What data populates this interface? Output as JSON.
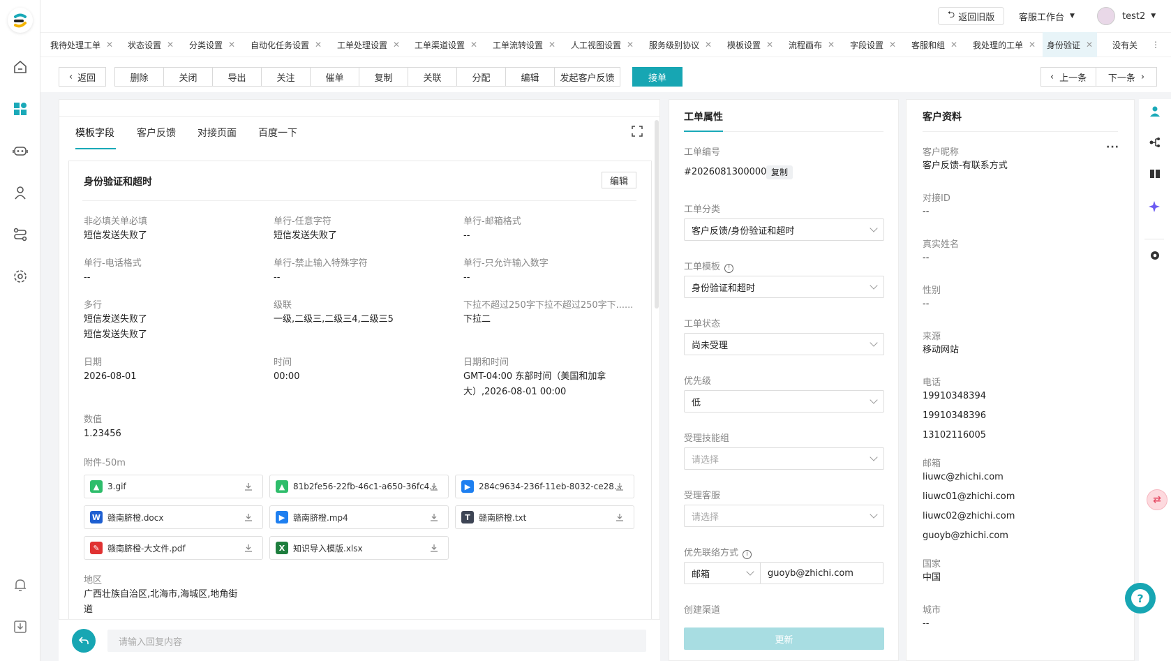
{
  "header": {
    "back_old": "返回旧版",
    "workspace": "客服工作台",
    "user": "test2"
  },
  "tabs": [
    {
      "label": "我待处理工单"
    },
    {
      "label": "状态设置"
    },
    {
      "label": "分类设置"
    },
    {
      "label": "自动化任务设置"
    },
    {
      "label": "工单处理设置"
    },
    {
      "label": "工单渠道设置"
    },
    {
      "label": "工单流转设置"
    },
    {
      "label": "人工视图设置"
    },
    {
      "label": "服务级别协议"
    },
    {
      "label": "模板设置"
    },
    {
      "label": "流程画布"
    },
    {
      "label": "字段设置"
    },
    {
      "label": "客服和组"
    },
    {
      "label": "我处理的工单"
    },
    {
      "label": "身份验证"
    },
    {
      "label": "没有关"
    }
  ],
  "actions": {
    "back": "返回",
    "buttons": [
      "删除",
      "关闭",
      "导出",
      "关注",
      "催单",
      "复制",
      "关联",
      "分配",
      "编辑",
      "发起客户反馈"
    ],
    "accept": "接单",
    "prev": "上一条",
    "next": "下一条"
  },
  "content_tabs": [
    "模板字段",
    "客户反馈",
    "对接页面",
    "百度一下"
  ],
  "section": {
    "title": "身份验证和超时",
    "edit": "编辑"
  },
  "fields": [
    {
      "label": "非必填关单必填",
      "value": "短信发送失败了"
    },
    {
      "label": "单行-任意字符",
      "value": "短信发送失败了"
    },
    {
      "label": "单行-邮箱格式",
      "value": "--"
    },
    {
      "label": "单行-电话格式",
      "value": "--"
    },
    {
      "label": "单行-禁止输入特殊字符",
      "value": "--"
    },
    {
      "label": "单行-只允许输入数字",
      "value": "--"
    },
    {
      "label": "多行",
      "value": "短信发送失败了",
      "value2": "短信发送失败了"
    },
    {
      "label": "级联",
      "value": "一级,二级三,二级三4,二级三5"
    },
    {
      "label": "下拉不超过250字下拉不超过250字下......",
      "value": "下拉二"
    },
    {
      "label": "日期",
      "value": "2026-08-01"
    },
    {
      "label": "时间",
      "value": "00:00"
    },
    {
      "label": "日期和时间",
      "value": "GMT-04:00 东部时间（美国和加拿",
      "value2": "大）,2026-08-01 00:00"
    },
    {
      "label": "数值",
      "value": "1.23456"
    }
  ],
  "attachments": {
    "label": "附件-50m",
    "files": [
      {
        "name": "3.gif",
        "type": "img",
        "color": "#2ebd6b",
        "glyph": "▲"
      },
      {
        "name": "81b2fe56-22fb-46c1-a650-36fc4...",
        "type": "img",
        "color": "#2ebd6b",
        "glyph": "▲"
      },
      {
        "name": "284c9634-236f-11eb-8032-ce28...",
        "type": "video",
        "color": "#1e7ff0",
        "glyph": "▶"
      },
      {
        "name": "赣南脐橙.docx",
        "type": "word",
        "color": "#1e5fd1",
        "glyph": "W"
      },
      {
        "name": "赣南脐橙.mp4",
        "type": "video",
        "color": "#1e7ff0",
        "glyph": "▶"
      },
      {
        "name": "赣南脐橙.txt",
        "type": "text",
        "color": "#3d4454",
        "glyph": "T"
      },
      {
        "name": "赣南脐橙-大文件.pdf",
        "type": "pdf",
        "color": "#e03232",
        "glyph": "✎"
      },
      {
        "name": "知识导入模版.xlsx",
        "type": "excel",
        "color": "#1e7e3e",
        "glyph": "X"
      }
    ]
  },
  "region": {
    "label": "地区",
    "value": "广西壮族自治区,北海市,海城区,地角街",
    "value2": "道"
  },
  "reply": {
    "placeholder": "请输入回复内容"
  },
  "props": {
    "title": "工单属性",
    "id_label": "工单编号",
    "id": "#20260813000002",
    "copy": "复制",
    "category_label": "工单分类",
    "category": "客户反馈/身份验证和超时",
    "template_label": "工单模板",
    "template": "身份验证和超时",
    "status_label": "工单状态",
    "status": "尚未受理",
    "priority_label": "优先级",
    "priority": "低",
    "group_label": "受理技能组",
    "group_ph": "请选择",
    "agent_label": "受理客服",
    "agent_ph": "请选择",
    "contact_label": "优先联络方式",
    "contact_type": "邮箱",
    "contact_value": "guoyb@zhichi.com",
    "channel_label": "创建渠道",
    "update": "更新"
  },
  "customer": {
    "title": "客户资料",
    "more": "···",
    "items": [
      {
        "label": "客户昵称",
        "values": [
          "客户反馈-有联系方式"
        ]
      },
      {
        "label": "对接ID",
        "values": [
          "--"
        ]
      },
      {
        "label": "真实姓名",
        "values": [
          "--"
        ]
      },
      {
        "label": "性别",
        "values": [
          "--"
        ]
      },
      {
        "label": "来源",
        "values": [
          "移动网站"
        ]
      },
      {
        "label": "电话",
        "values": [
          "19910348394",
          "19910348396",
          "13102116005"
        ]
      },
      {
        "label": "邮箱",
        "values": [
          "liuwc@zhichi.com",
          "liuwc01@zhichi.com",
          "liuwc02@zhichi.com",
          "guoyb@zhichi.com"
        ]
      },
      {
        "label": "国家",
        "values": [
          "中国"
        ]
      },
      {
        "label": "城市",
        "values": [
          "--"
        ]
      }
    ]
  },
  "colors": {
    "accent": "#1aa9b8",
    "primary_btn": "#17a6b3"
  }
}
